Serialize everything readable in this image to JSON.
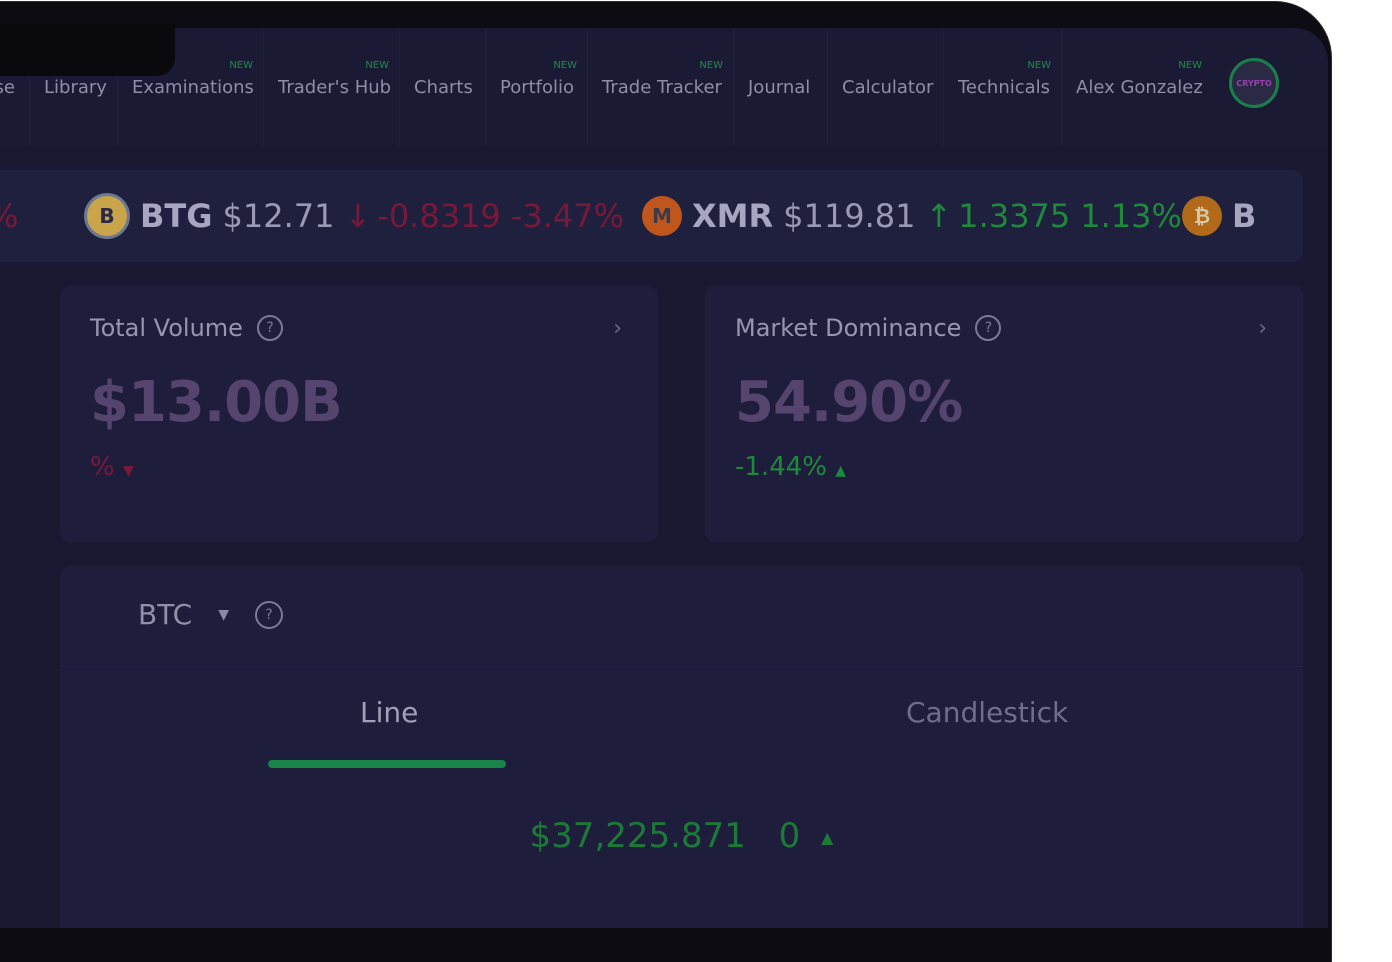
{
  "nav": {
    "items": [
      {
        "label": "se",
        "new": false
      },
      {
        "label": "Library",
        "new": false
      },
      {
        "label": "Examinations",
        "new": true
      },
      {
        "label": "Trader's Hub",
        "new": true
      },
      {
        "label": "Charts",
        "new": false
      },
      {
        "label": "Portfolio",
        "new": true
      },
      {
        "label": "Trade Tracker",
        "new": true
      },
      {
        "label": "Journal",
        "new": false
      },
      {
        "label": "Calculator",
        "new": false
      },
      {
        "label": "Technicals",
        "new": true
      },
      {
        "label": "Alex Gonzalez",
        "new": true
      }
    ],
    "new_label": "NEW",
    "avatar_text": "CRYPTO"
  },
  "ticker": {
    "items": [
      {
        "symbol": "",
        "price": "",
        "change": "",
        "percent": "%",
        "direction": "down"
      },
      {
        "symbol": "BTG",
        "price": "$12.71",
        "change": "-0.8319",
        "percent": "-3.47%",
        "direction": "down",
        "icon_char": "B"
      },
      {
        "symbol": "XMR",
        "price": "$119.81",
        "change": "1.3375",
        "percent": "1.13%",
        "direction": "up",
        "icon_char": "M"
      },
      {
        "symbol": "B",
        "price": "",
        "change": "",
        "percent": "",
        "direction": "",
        "icon_char": "₿"
      }
    ]
  },
  "cards": {
    "total_volume": {
      "title": "Total Volume",
      "value": "$13.00B",
      "change": "%",
      "direction": "down"
    },
    "market_dominance": {
      "title": "Market Dominance",
      "value": "54.90%",
      "change": "-1.44%",
      "direction": "up"
    }
  },
  "chart_panel": {
    "coin": "BTC",
    "tabs": [
      "Line",
      "Candlestick"
    ],
    "active_tab": "Line",
    "price": "$37,225.871",
    "change": "0"
  },
  "colors": {
    "up": "#1c8a3a",
    "down": "#7a1838",
    "accent": "#18844a",
    "background": "#181830"
  }
}
